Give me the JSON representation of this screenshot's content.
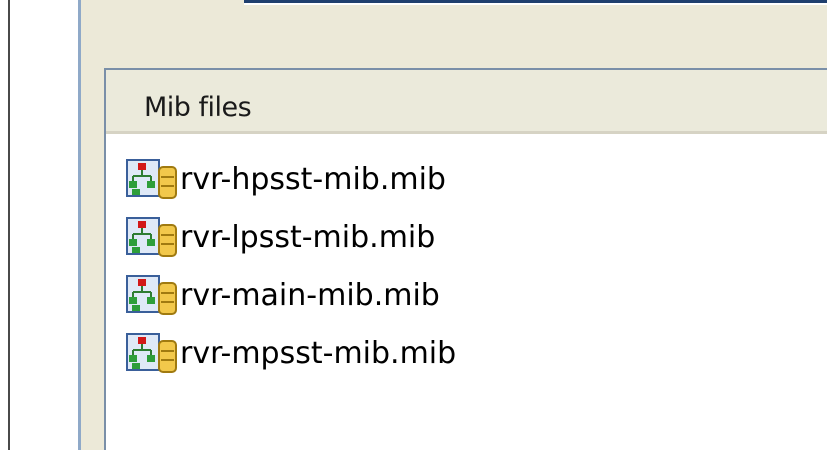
{
  "list": {
    "header": "Mib files",
    "items": [
      {
        "label": "rvr-hpsst-mib.mib",
        "icon": "mib-file-icon"
      },
      {
        "label": "rvr-lpsst-mib.mib",
        "icon": "mib-file-icon"
      },
      {
        "label": "rvr-main-mib.mib",
        "icon": "mib-file-icon"
      },
      {
        "label": "rvr-mpsst-mib.mib",
        "icon": "mib-file-icon"
      }
    ]
  },
  "colors": {
    "panel_background": "#ece9d8",
    "list_background": "#ffffff",
    "header_background": "#ebeadb",
    "accent_border": "#1f3f6e"
  }
}
